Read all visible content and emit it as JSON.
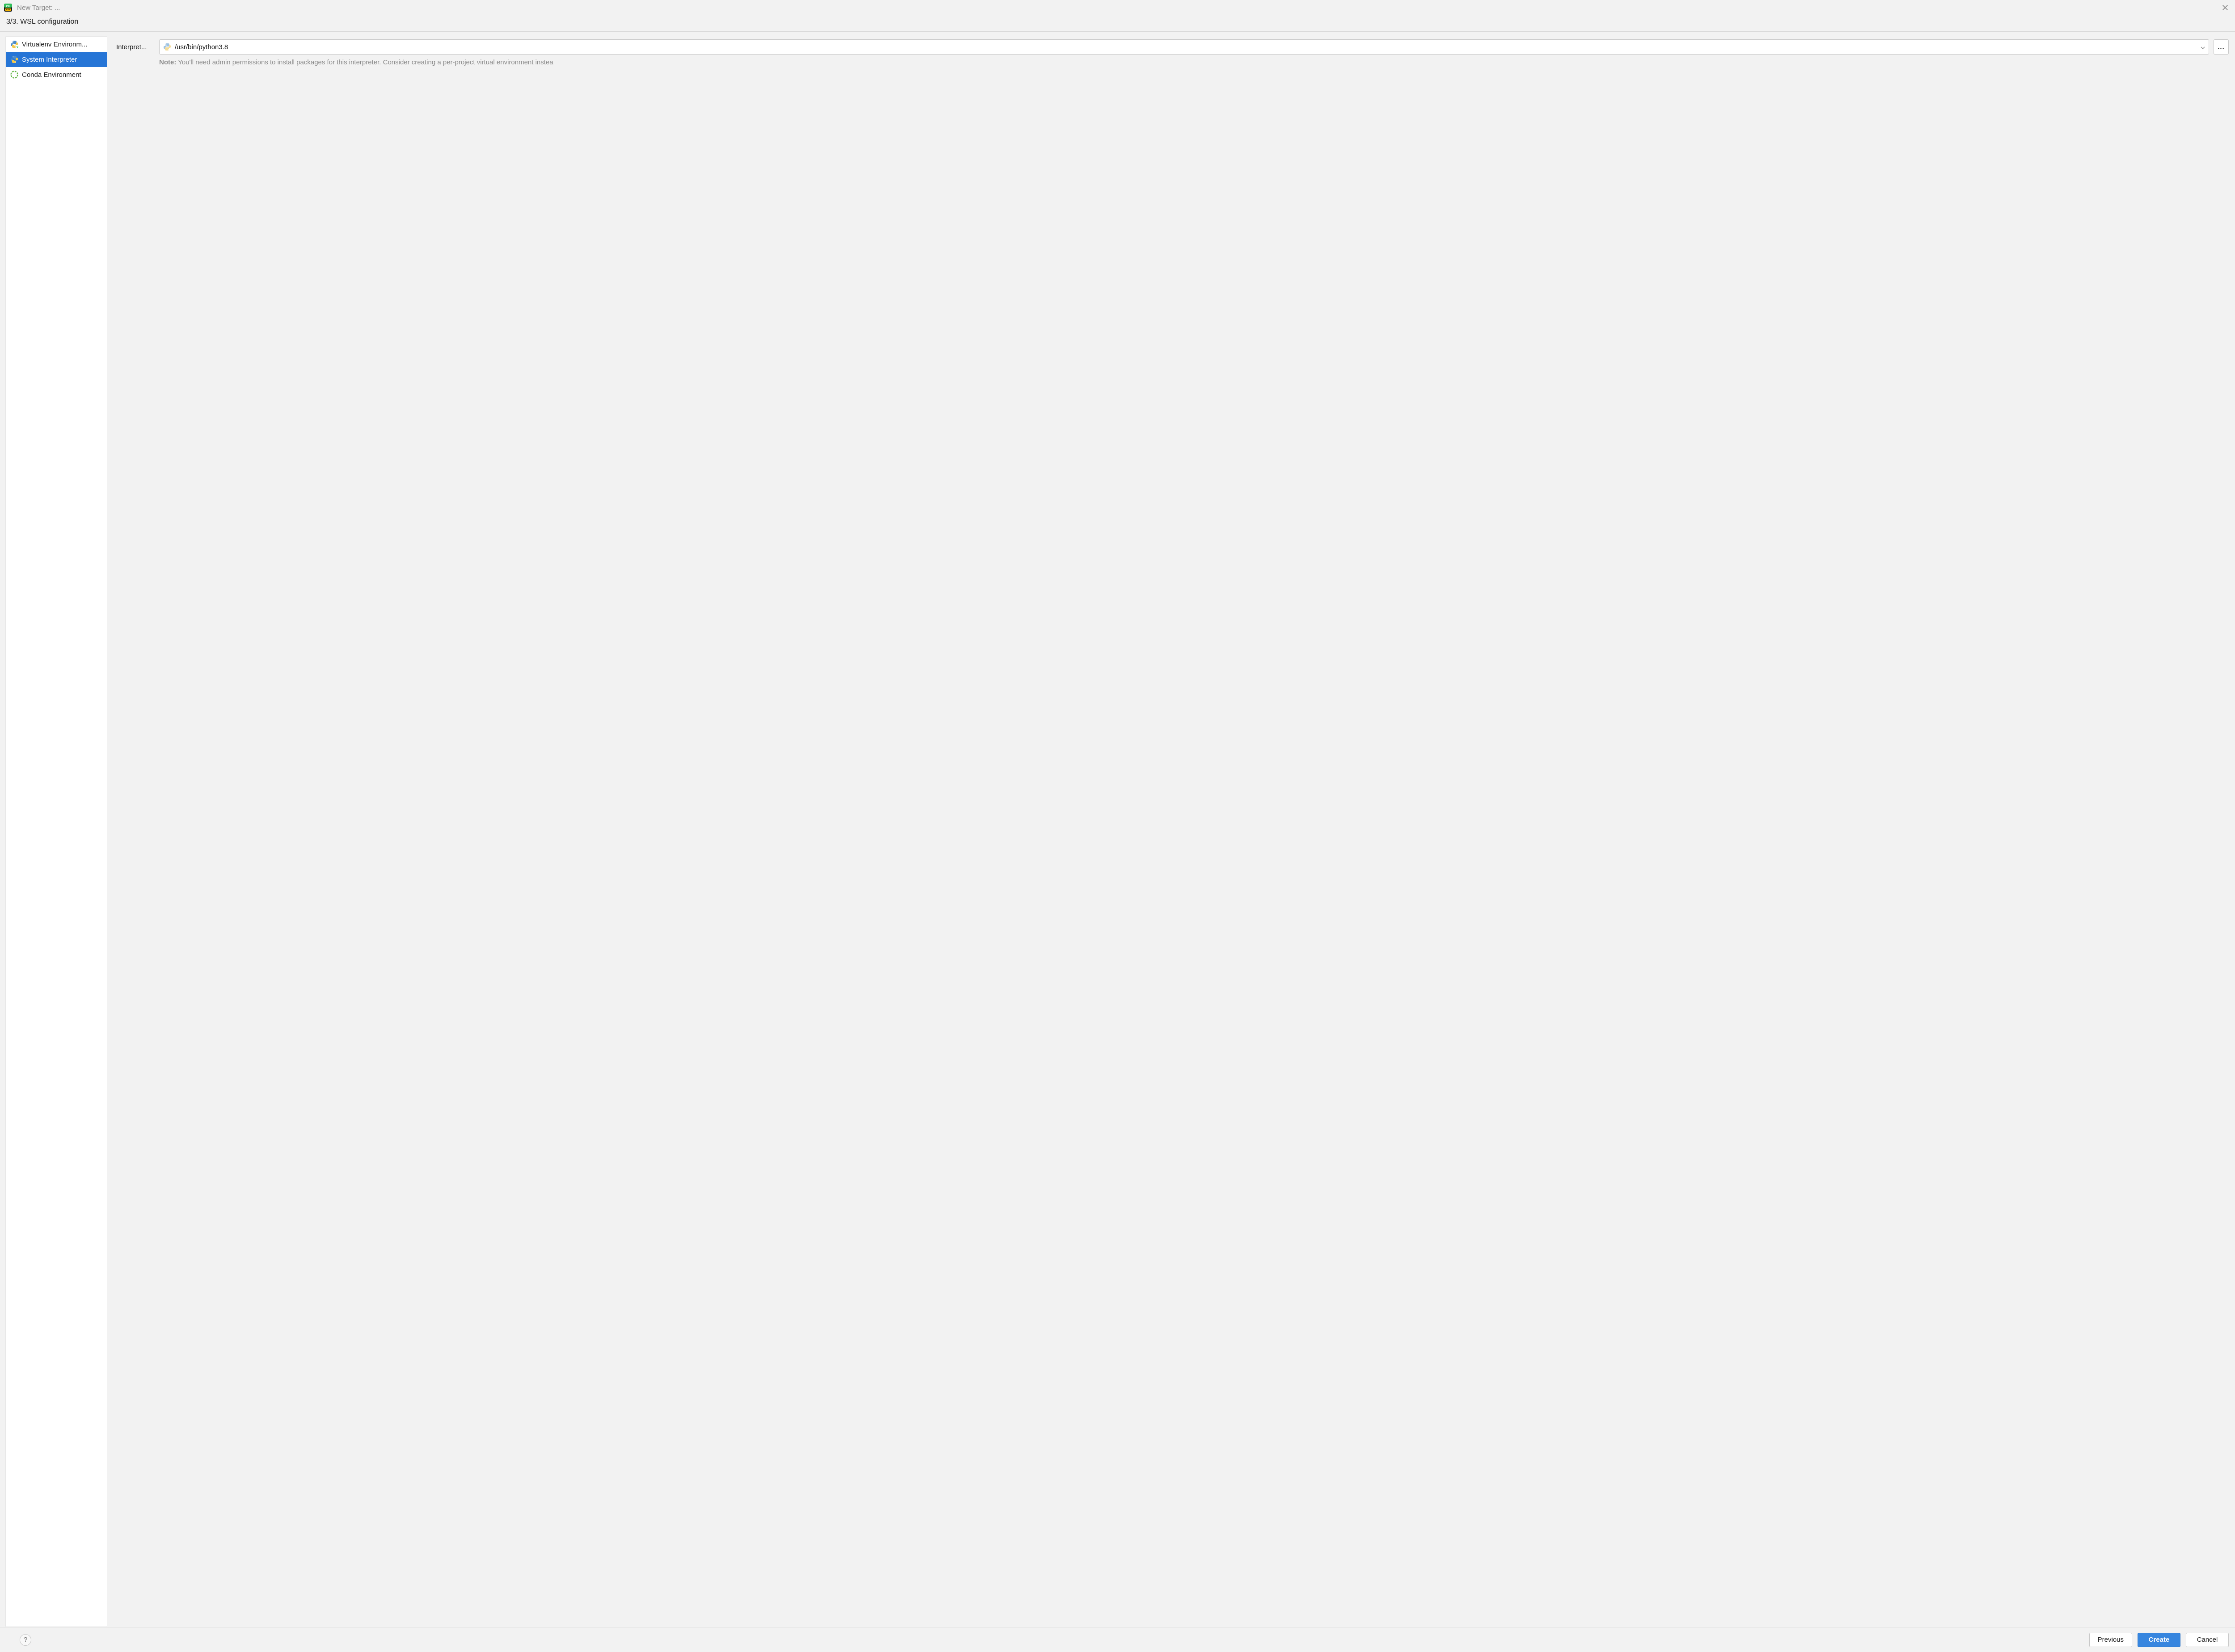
{
  "titlebar": {
    "title": "New Target: ..."
  },
  "step": {
    "label": "3/3. WSL configuration"
  },
  "sidebar": {
    "items": [
      {
        "label": "Virtualenv Environm...",
        "selected": false,
        "icon": "python-venv"
      },
      {
        "label": "System Interpreter",
        "selected": true,
        "icon": "python"
      },
      {
        "label": "Conda Environment",
        "selected": false,
        "icon": "conda"
      }
    ]
  },
  "form": {
    "interpreter_label": "Interpret...",
    "interpreter_value": "/usr/bin/python3.8",
    "browse_label": "...",
    "note_bold": "Note:",
    "note_text": " You'll need admin permissions to install packages for this interpreter. Consider creating a per-project virtual environment instea"
  },
  "footer": {
    "help": "?",
    "previous": "Previous",
    "create": "Create",
    "cancel": "Cancel"
  },
  "colors": {
    "selection": "#2675d6",
    "primary": "#3786df"
  }
}
